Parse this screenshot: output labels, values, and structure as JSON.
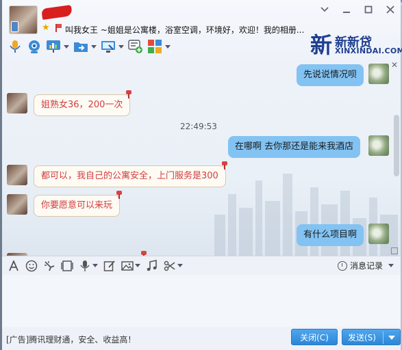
{
  "header": {
    "status_text": "叫我女王 ~姐姐是公寓楼，浴室空调，环境好，欢迎！我的相册...",
    "window_buttons": [
      "chevron-down-icon",
      "minimize-icon",
      "maximize-icon",
      "close-icon"
    ]
  },
  "logo": {
    "glyph": "新",
    "name_cn": "新新贷",
    "name_en": "XINXINDAI.COM"
  },
  "messages": [
    {
      "side": "out",
      "text": "先说说情况呗"
    },
    {
      "side": "in",
      "text": "姐熟女36，200一次"
    },
    {
      "side": "time",
      "text": "22:49:53"
    },
    {
      "side": "out",
      "text": "在哪啊 去你那还是能来我酒店"
    },
    {
      "side": "in",
      "text": "都可以，我自己的公寓安全，上门服务是300"
    },
    {
      "side": "in",
      "text": "你要愿意可以来玩"
    },
    {
      "side": "out",
      "text": "有什么项目啊"
    }
  ],
  "input_toolbar": {
    "history_label": "消息记录"
  },
  "bottom": {
    "ad_text": "[广告]腾讯理财通，安全、收益高！",
    "close_label": "关闭(C)",
    "send_label": "发送(S)"
  },
  "colors": {
    "outgoing_bubble": "#82c3f3",
    "incoming_text": "#d23c3c",
    "button": "#2b86d8"
  }
}
